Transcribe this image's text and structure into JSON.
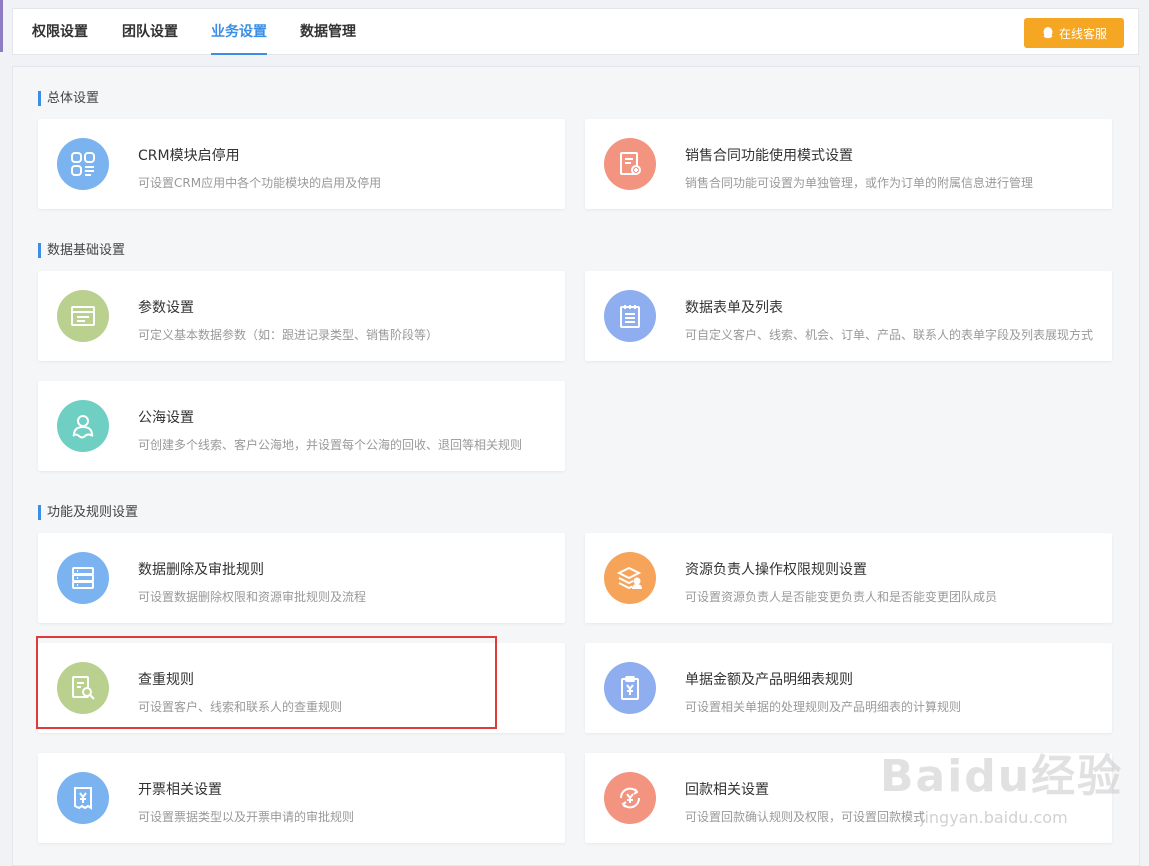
{
  "tabs": [
    {
      "label": "权限设置"
    },
    {
      "label": "团队设置"
    },
    {
      "label": "业务设置",
      "active": true
    },
    {
      "label": "数据管理"
    }
  ],
  "service_button": "在线客服",
  "sections": {
    "general": "总体设置",
    "data_base": "数据基础设置",
    "features": "功能及规则设置"
  },
  "cards": {
    "crm_module": {
      "title": "CRM模块启停用",
      "desc": "可设置CRM应用中各个功能模块的启用及停用"
    },
    "contract_mode": {
      "title": "销售合同功能使用模式设置",
      "desc": "销售合同功能可设置为单独管理，或作为订单的附属信息进行管理"
    },
    "params": {
      "title": "参数设置",
      "desc": "可定义基本数据参数（如：跟进记录类型、销售阶段等）"
    },
    "forms": {
      "title": "数据表单及列表",
      "desc": "可自定义客户、线索、机会、订单、产品、联系人的表单字段及列表展现方式"
    },
    "pool": {
      "title": "公海设置",
      "desc": "可创建多个线索、客户公海地，并设置每个公海的回收、退回等相关规则"
    },
    "delete_approval": {
      "title": "数据删除及审批规则",
      "desc": "可设置数据删除权限和资源审批规则及流程"
    },
    "owner_permission": {
      "title": "资源负责人操作权限规则设置",
      "desc": "可设置资源负责人是否能变更负责人和是否能变更团队成员"
    },
    "dedup": {
      "title": "查重规则",
      "desc": "可设置客户、线索和联系人的查重规则"
    },
    "amount": {
      "title": "单据金额及产品明细表规则",
      "desc": "可设置相关单据的处理规则及产品明细表的计算规则"
    },
    "invoice": {
      "title": "开票相关设置",
      "desc": "可设置票据类型以及开票申请的审批规则"
    },
    "payment": {
      "title": "回款相关设置",
      "desc": "可设置回款确认规则及权限，可设置回款模式"
    }
  },
  "watermark": {
    "main": "Baidu经验",
    "sub": "jingyan.baidu.com"
  },
  "colors": {
    "accent": "#3a8ee6",
    "service": "#f5a623",
    "blue_icon": "#7ab3f0",
    "salmon_icon": "#f29480",
    "green_icon": "#b9d08e",
    "periwinkle_icon": "#8faeef",
    "teal_icon": "#6fcfc3",
    "orange_icon": "#f6a45a",
    "highlight": "#e03b3b"
  }
}
